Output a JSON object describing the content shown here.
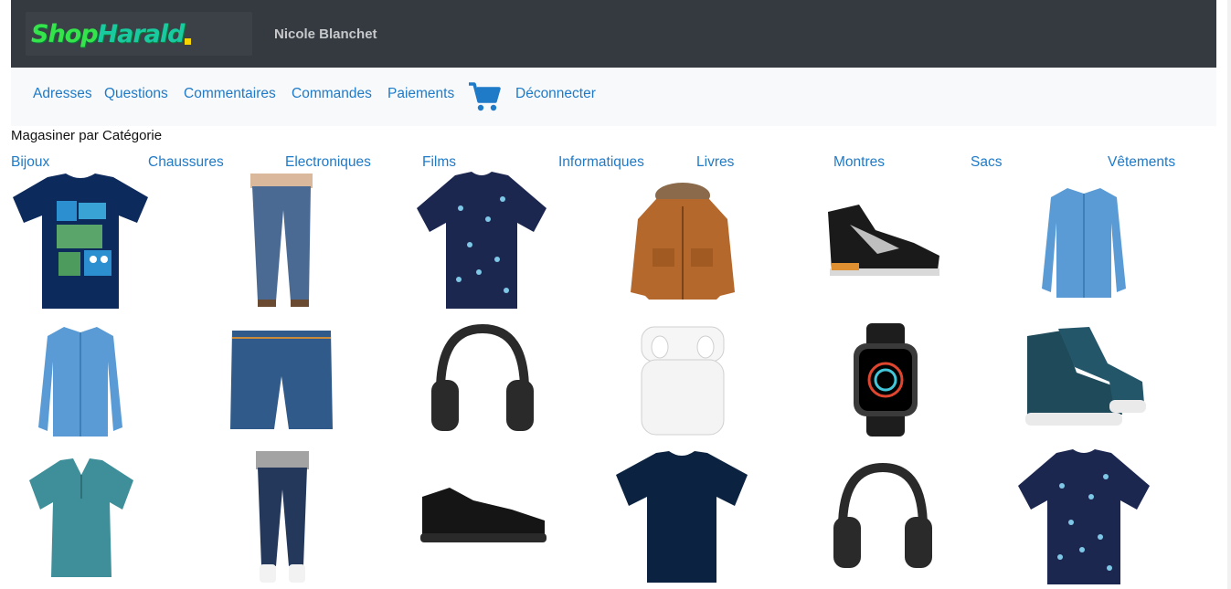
{
  "header": {
    "logo_text_a": "Shop",
    "logo_text_b": "Harald",
    "user_name": "Nicole Blanchet"
  },
  "nav": {
    "links": [
      "Adresses",
      "Questions",
      "Commentaires",
      "Commandes",
      "Paiements"
    ],
    "cart_icon": "shopping-cart-icon",
    "logout": "Déconnecter"
  },
  "section_title": "Magasiner par Catégorie",
  "categories": [
    "Bijoux",
    "Chaussures",
    "Electroniques",
    "Films",
    "Informatiques",
    "Livres",
    "Montres",
    "Sacs",
    "Vêtements"
  ],
  "products": [
    {
      "kind": "graphic-tshirt",
      "color": "#0d2a5c"
    },
    {
      "kind": "jeans",
      "color": "#4a6a93"
    },
    {
      "kind": "patterned-shirt",
      "color": "#1c2750"
    },
    {
      "kind": "jacket",
      "color": "#b5682c"
    },
    {
      "kind": "sneaker",
      "color": "#1a1a1a"
    },
    {
      "kind": "dress-shirt",
      "color": "#5a9bd5"
    },
    {
      "kind": "dress-shirt",
      "color": "#5a9bd5"
    },
    {
      "kind": "shorts",
      "color": "#2f5a89"
    },
    {
      "kind": "headphones",
      "color": "#2a2a2a"
    },
    {
      "kind": "earbuds",
      "color": "#f4f4f4"
    },
    {
      "kind": "watch",
      "color": "#1d1d1d"
    },
    {
      "kind": "hightop-shoe",
      "color": "#1e4a5a"
    },
    {
      "kind": "polo",
      "color": "#3e8f9a"
    },
    {
      "kind": "jeans",
      "color": "#24385c"
    },
    {
      "kind": "running-shoe",
      "color": "#151515"
    },
    {
      "kind": "plain-tshirt",
      "color": "#0b2340"
    },
    {
      "kind": "headphones",
      "color": "#2a2a2a"
    },
    {
      "kind": "patterned-shirt",
      "color": "#1c2750"
    }
  ]
}
